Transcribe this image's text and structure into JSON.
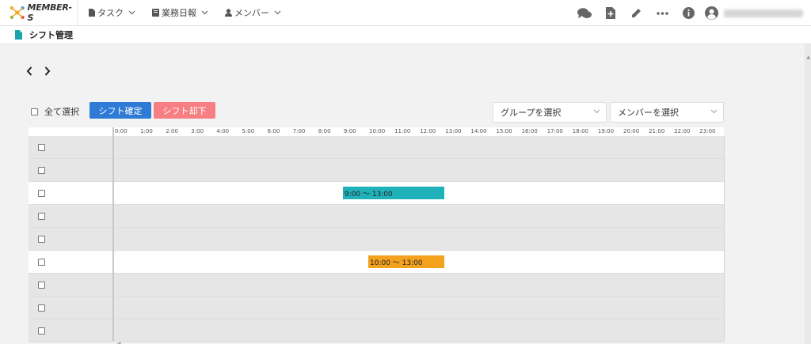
{
  "app": {
    "logo_text": "MEMBER-S"
  },
  "nav": [
    {
      "label": "タスク",
      "icon": "document-icon"
    },
    {
      "label": "業務日報",
      "icon": "notebook-icon"
    },
    {
      "label": "メンバー",
      "icon": "person-icon"
    }
  ],
  "topbar_icons": [
    "chat-icon",
    "add-document-icon",
    "pencil-icon",
    "more-icon",
    "info-icon",
    "user-avatar-icon"
  ],
  "user": {
    "name": ""
  },
  "page": {
    "title": "シフト管理"
  },
  "toolbar": {
    "date_range": "",
    "select_all_label": "全て選択",
    "confirm_label": "シフト確定",
    "reject_label": "シフト却下",
    "group_placeholder": "グループを選択",
    "member_placeholder": "メンバーを選択"
  },
  "colors": {
    "confirm_button": "#2e7bd6",
    "reject_button": "#f77f84",
    "shift_teal": "#20b2ba",
    "shift_orange": "#f4a21d",
    "logo_accent": "#f5a623"
  },
  "grid": {
    "hours": [
      "0:00",
      "1:00",
      "2:00",
      "3:00",
      "4:00",
      "5:00",
      "6:00",
      "7:00",
      "8:00",
      "9:00",
      "10:00",
      "11:00",
      "12:00",
      "13:00",
      "14:00",
      "15:00",
      "16:00",
      "17:00",
      "18:00",
      "19:00",
      "20:00",
      "21:00",
      "22:00",
      "23:00"
    ],
    "rows": [
      {
        "name": "",
        "shaded": true
      },
      {
        "name": "",
        "shaded": true
      },
      {
        "name": "",
        "shaded": false,
        "shift": {
          "label": "9:00 ～ 13:00",
          "start": 9,
          "end": 13,
          "color": "#20b2ba"
        }
      },
      {
        "name": "",
        "shaded": true
      },
      {
        "name": "",
        "shaded": true
      },
      {
        "name": "",
        "shaded": false,
        "shift": {
          "label": "10:00 ～ 13:00",
          "start": 10,
          "end": 13,
          "color": "#f4a21d"
        }
      },
      {
        "name": "",
        "shaded": true
      },
      {
        "name": "",
        "shaded": true
      },
      {
        "name": "",
        "shaded": true
      }
    ]
  }
}
